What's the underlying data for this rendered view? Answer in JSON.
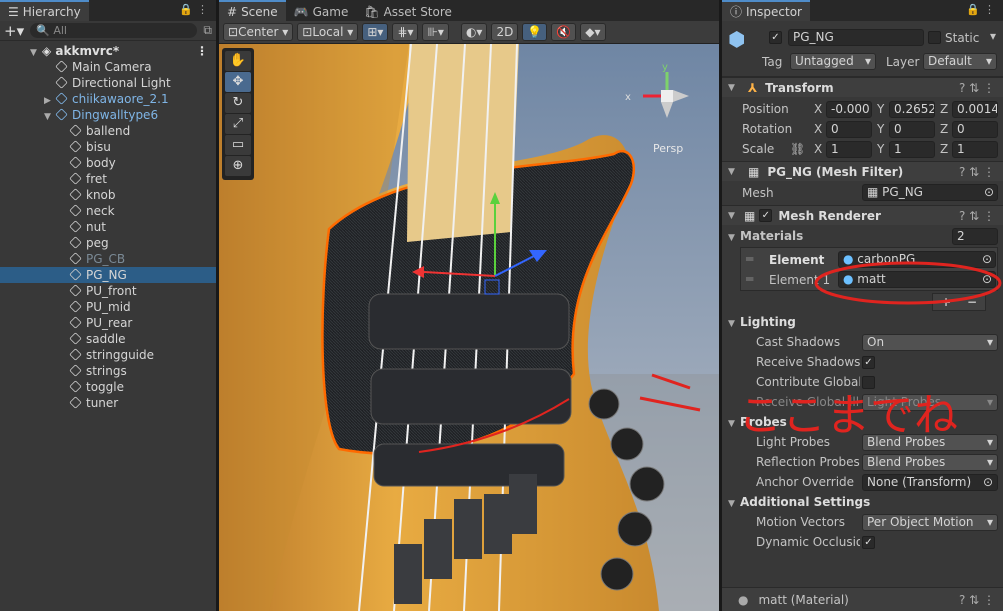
{
  "hierarchy": {
    "tab": "Hierarchy",
    "search_placeholder": "All",
    "scene": "akkmvrc*",
    "items": [
      "Main Camera",
      "Directional Light",
      "chiikawaore_2.1",
      "Dingwalltype6",
      "ballend",
      "bisu",
      "body",
      "fret",
      "knob",
      "neck",
      "nut",
      "peg",
      "PG_CB",
      "PG_NG",
      "PU_front",
      "PU_mid",
      "PU_rear",
      "saddle",
      "stringguide",
      "strings",
      "toggle",
      "tuner"
    ]
  },
  "scene": {
    "tabs": [
      "Scene",
      "Game",
      "Asset Store"
    ],
    "pivot": "Center",
    "space": "Local",
    "mode2d": "2D",
    "persp": "Persp",
    "gizmo_x": "x",
    "gizmo_y": "y"
  },
  "inspector": {
    "tab": "Inspector",
    "object_name": "PG_NG",
    "static_label": "Static",
    "tag_label": "Tag",
    "tag": "Untagged",
    "layer_label": "Layer",
    "layer": "Default",
    "transform": {
      "title": "Transform",
      "position_label": "Position",
      "rotation_label": "Rotation",
      "scale_label": "Scale",
      "x": "X",
      "y": "Y",
      "z": "Z",
      "position": [
        "-0.000",
        "0.2652",
        "0.0014"
      ],
      "rotation": [
        "0",
        "0",
        "0"
      ],
      "scale": [
        "1",
        "1",
        "1"
      ]
    },
    "mesh_filter": {
      "title": "PG_NG (Mesh Filter)",
      "mesh_label": "Mesh",
      "mesh": "PG_NG"
    },
    "mesh_renderer": {
      "title": "Mesh Renderer",
      "materials_label": "Materials",
      "materials_count": "2",
      "elements": [
        {
          "label": "Element",
          "value": "carbonPG"
        },
        {
          "label": "Element 1",
          "value": "matt"
        }
      ],
      "add": "+",
      "remove": "−",
      "lighting": "Lighting",
      "cast_shadows_label": "Cast Shadows",
      "cast_shadows": "On",
      "receive_shadows_label": "Receive Shadows",
      "contribute_gi_label": "Contribute Global",
      "receive_gi_label": "Receive Global Illu",
      "receive_gi": "Light Probes",
      "probes": "Probes",
      "light_probes_label": "Light Probes",
      "light_probes": "Blend Probes",
      "reflection_probes_label": "Reflection Probes",
      "reflection_probes": "Blend Probes",
      "anchor_label": "Anchor Override",
      "anchor": "None (Transform)",
      "additional": "Additional Settings",
      "motion_label": "Motion Vectors",
      "motion": "Per Object Motion",
      "dynamic_label": "Dynamic Occlusion"
    },
    "material_footer": "matt (Material)"
  },
  "annotation": "ここまでね",
  "colors": {
    "selection": "#2c5d87",
    "orange_outline": "#ff6a00",
    "red_ink": "#e0241f",
    "guitar": "#e3a43a"
  }
}
